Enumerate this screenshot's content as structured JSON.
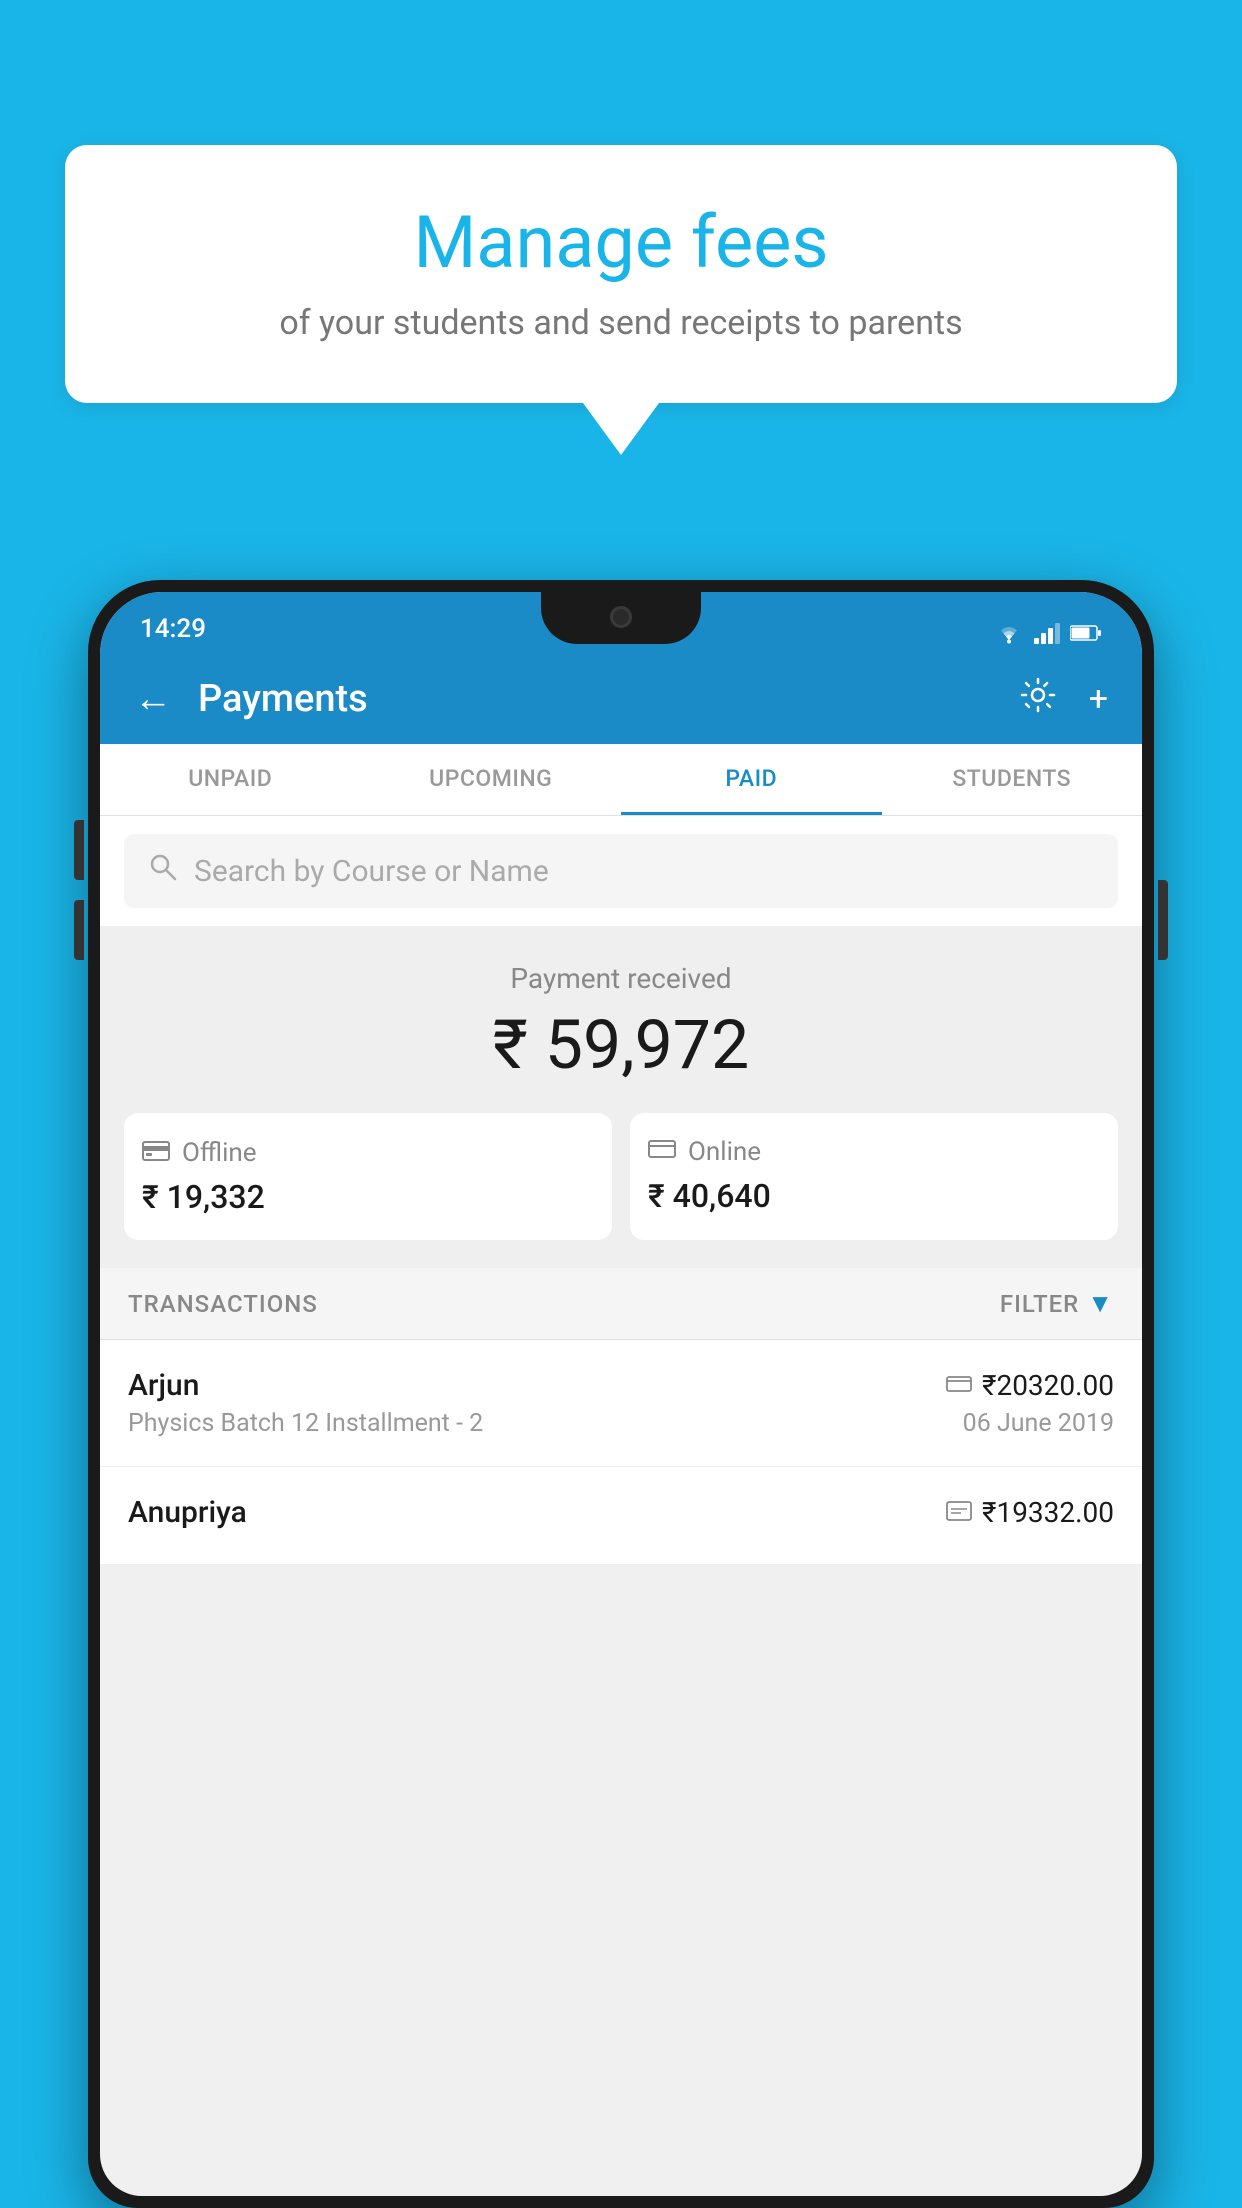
{
  "background_color": "#1ab5e8",
  "speech_bubble": {
    "title": "Manage fees",
    "subtitle": "of your students and send receipts to parents"
  },
  "status_bar": {
    "time": "14:29",
    "wifi": "▼",
    "signal": "▲",
    "battery": "▮"
  },
  "app_bar": {
    "back_label": "←",
    "title": "Payments",
    "gear_label": "⚙",
    "plus_label": "+"
  },
  "tabs": [
    {
      "label": "UNPAID",
      "active": false
    },
    {
      "label": "UPCOMING",
      "active": false
    },
    {
      "label": "PAID",
      "active": true
    },
    {
      "label": "STUDENTS",
      "active": false
    }
  ],
  "search": {
    "placeholder": "Search by Course or Name"
  },
  "payment_received": {
    "label": "Payment received",
    "amount": "₹ 59,972",
    "offline": {
      "label": "Offline",
      "amount": "₹ 19,332"
    },
    "online": {
      "label": "Online",
      "amount": "₹ 40,640"
    }
  },
  "transactions_section": {
    "label": "TRANSACTIONS",
    "filter_label": "FILTER"
  },
  "transactions": [
    {
      "name": "Arjun",
      "amount": "₹20320.00",
      "course": "Physics Batch 12 Installment - 2",
      "date": "06 June 2019",
      "payment_type": "online"
    },
    {
      "name": "Anupriya",
      "amount": "₹19332.00",
      "course": "",
      "date": "",
      "payment_type": "offline"
    }
  ]
}
